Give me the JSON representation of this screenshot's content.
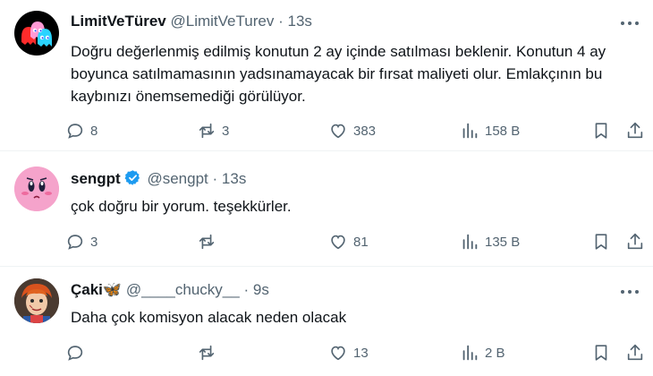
{
  "tweets": [
    {
      "display_name": "LimitVeTürev",
      "handle": "@LimitVeTurev",
      "separator": "·",
      "time": "13s",
      "text": "Doğru değerlenmiş edilmiş konutun 2 ay içinde satılması beklenir. Konutun 4 ay boyunca satılmamasının yadsınamayacak bir fırsat maliyeti olur. Emlakçının bu kaybınızı önemsemediği görülüyor.",
      "replies": "8",
      "reposts": "3",
      "likes": "383",
      "views": "158 B"
    },
    {
      "display_name": "sengpt",
      "handle": "@sengpt",
      "separator": "·",
      "time": "13s",
      "verified": true,
      "text": "çok doğru bir yorum. teşekkürler.",
      "replies": "3",
      "reposts": "",
      "likes": "81",
      "views": "135 B"
    },
    {
      "display_name": "Çaki🦋",
      "handle": "@____chucky__",
      "separator": "·",
      "time": "9s",
      "text": "Daha çok komisyon alacak neden olacak",
      "replies": "",
      "reposts": "",
      "likes": "13",
      "views": "2 B"
    }
  ],
  "icons": {
    "reply": "speech-bubble-icon",
    "repost": "repost-arrows-icon",
    "like": "heart-icon",
    "views": "bar-chart-icon",
    "bookmark": "bookmark-icon",
    "share": "share-upload-icon",
    "more": "more-dots-icon",
    "verified": "verified-badge-icon"
  },
  "colors": {
    "text": "#0f1419",
    "muted": "#536471",
    "verified": "#1d9bf0",
    "separator": "#eff3f4"
  }
}
